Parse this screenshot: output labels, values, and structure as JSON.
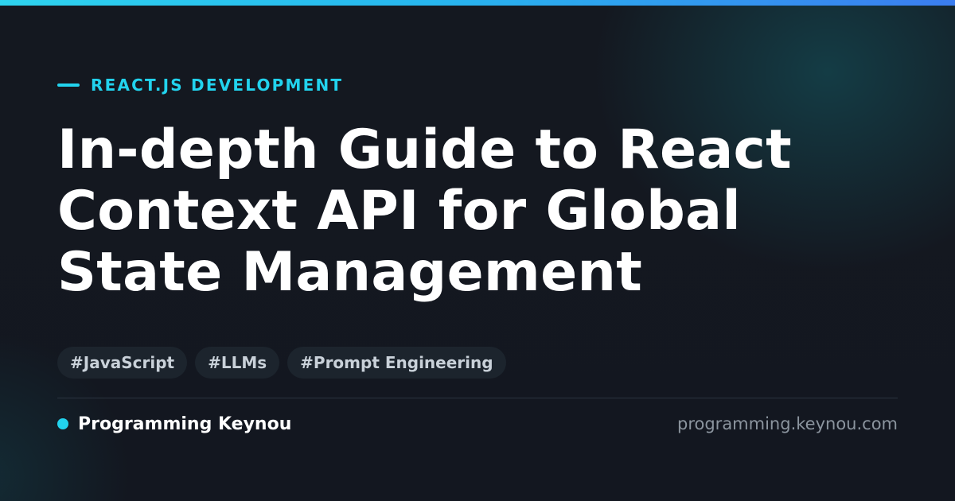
{
  "category": {
    "label": "REACT.JS DEVELOPMENT"
  },
  "title": {
    "lines": [
      "In-depth Guide to React",
      "Context API for Global",
      "State Management"
    ]
  },
  "tags": [
    "#JavaScript",
    "#LLMs",
    "#Prompt Engineering"
  ],
  "footer": {
    "brand": "Programming Keynou",
    "url": "programming.keynou.com"
  },
  "colors": {
    "accent": "#22d3ee",
    "background": "#13171f",
    "title": "#ffffff",
    "tag_background": "#1c242d",
    "tag_text": "#c9d1d9",
    "muted": "#8b949e"
  }
}
